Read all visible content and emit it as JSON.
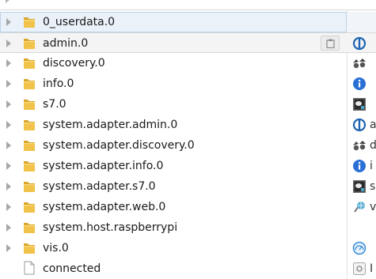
{
  "tree": {
    "rows": [
      {
        "label": "0_userdata.0",
        "type": "folder",
        "selected": true,
        "adapter_icon": "",
        "adapter_text": ""
      },
      {
        "label": "admin.0",
        "type": "folder",
        "hover": true,
        "action_icon": "clipboard-icon",
        "adapter_icon": "admin-power-icon",
        "adapter_text": ""
      },
      {
        "label": "discovery.0",
        "type": "folder",
        "adapter_icon": "binoculars-icon",
        "adapter_text": ""
      },
      {
        "label": "info.0",
        "type": "folder",
        "adapter_icon": "info-icon",
        "adapter_text": ""
      },
      {
        "label": "s7.0",
        "type": "folder",
        "adapter_icon": "s7-plc-icon",
        "adapter_text": ""
      },
      {
        "label": "system.adapter.admin.0",
        "type": "folder",
        "adapter_icon": "admin-power-icon",
        "adapter_text": "a"
      },
      {
        "label": "system.adapter.discovery.0",
        "type": "folder",
        "adapter_icon": "binoculars-icon",
        "adapter_text": "d"
      },
      {
        "label": "system.adapter.info.0",
        "type": "folder",
        "adapter_icon": "info-icon",
        "adapter_text": "i"
      },
      {
        "label": "system.adapter.s7.0",
        "type": "folder",
        "adapter_icon": "s7-plc-icon",
        "adapter_text": "s"
      },
      {
        "label": "system.adapter.web.0",
        "type": "folder",
        "adapter_icon": "web-globe-icon",
        "adapter_text": "v"
      },
      {
        "label": "system.host.raspberrypi",
        "type": "folder",
        "adapter_icon": "",
        "adapter_text": ""
      },
      {
        "label": "vis.0",
        "type": "folder",
        "adapter_icon": "vis-gauge-icon",
        "adapter_text": ""
      },
      {
        "label": "connected",
        "type": "state",
        "adapter_icon": "state-icon",
        "adapter_text": "I"
      }
    ]
  },
  "colors": {
    "folder": "#f2c34a",
    "folder_dark": "#d9a52a",
    "admin_blue": "#1f63b3",
    "info_blue": "#2a6fd6",
    "selection": "#eaf1f9"
  }
}
